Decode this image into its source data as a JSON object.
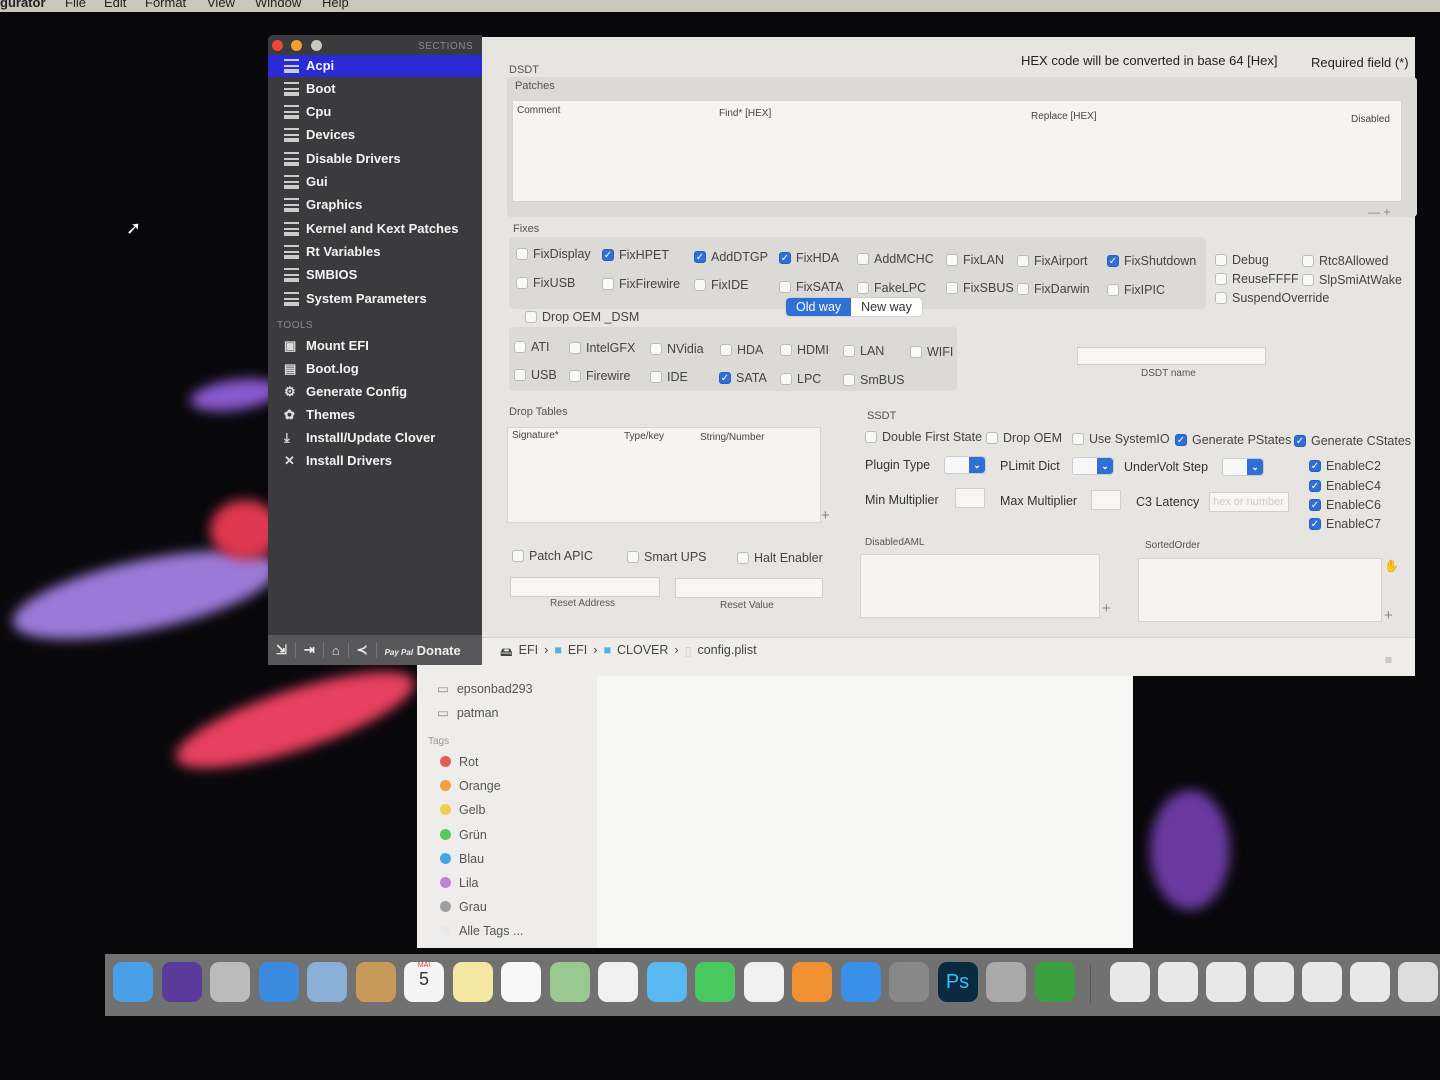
{
  "menubar": {
    "app": "gurator",
    "items": [
      "File",
      "Edit",
      "Format",
      "View",
      "Window",
      "Help"
    ]
  },
  "sidebar": {
    "sections_header": "SECTIONS",
    "sections": [
      "Acpi",
      "Boot",
      "Cpu",
      "Devices",
      "Disable Drivers",
      "Gui",
      "Graphics",
      "Kernel and Kext Patches",
      "Rt Variables",
      "SMBIOS",
      "System Parameters"
    ],
    "selected": "Acpi",
    "tools_header": "TOOLS",
    "tools": [
      {
        "label": "Mount EFI",
        "icon": "disk-icon"
      },
      {
        "label": "Boot.log",
        "icon": "log-icon"
      },
      {
        "label": "Generate Config",
        "icon": "gear-icon"
      },
      {
        "label": "Themes",
        "icon": "palette-icon"
      },
      {
        "label": "Install/Update Clover",
        "icon": "download-icon"
      },
      {
        "label": "Install Drivers",
        "icon": "tools-icon"
      }
    ],
    "footer": {
      "donate": "Donate",
      "paypal": "Pay Pal"
    }
  },
  "header": {
    "hex_note": "HEX code will be converted in base 64 [Hex]",
    "required": "Required field (*)"
  },
  "dsdt": {
    "title": "DSDT",
    "patches_label": "Patches",
    "columns": [
      "Comment",
      "Find* [HEX]",
      "Replace [HEX]",
      "Disabled"
    ],
    "fixes_label": "Fixes",
    "fixes": [
      {
        "l": "FixDisplay",
        "c": false
      },
      {
        "l": "FixHPET",
        "c": true
      },
      {
        "l": "AddDTGP",
        "c": true
      },
      {
        "l": "FixHDA",
        "c": true
      },
      {
        "l": "AddMCHC",
        "c": false
      },
      {
        "l": "FixLAN",
        "c": false
      },
      {
        "l": "FixAirport",
        "c": false
      },
      {
        "l": "FixShutdown",
        "c": true
      },
      {
        "l": "Debug",
        "c": false
      },
      {
        "l": "Rtc8Allowed",
        "c": false
      },
      {
        "l": "FixUSB",
        "c": false
      },
      {
        "l": "FixFirewire",
        "c": false
      },
      {
        "l": "FixIDE",
        "c": false
      },
      {
        "l": "FixSATA",
        "c": false
      },
      {
        "l": "FakeLPC",
        "c": false
      },
      {
        "l": "FixSBUS",
        "c": false
      },
      {
        "l": "FixDarwin",
        "c": false
      },
      {
        "l": "FixIPIC",
        "c": false
      },
      {
        "l": "ReuseFFFF",
        "c": false
      },
      {
        "l": "SlpSmiAtWake",
        "c": false
      },
      {
        "l": "SuspendOverride",
        "c": false
      }
    ],
    "way": {
      "old": "Old way",
      "new": "New way",
      "selected": "Old way"
    },
    "drop_oem_dsm": {
      "l": "Drop OEM _DSM",
      "c": false
    },
    "dsm": [
      {
        "l": "ATI",
        "c": false
      },
      {
        "l": "IntelGFX",
        "c": false
      },
      {
        "l": "NVidia",
        "c": false
      },
      {
        "l": "HDA",
        "c": false
      },
      {
        "l": "HDMI",
        "c": false
      },
      {
        "l": "LAN",
        "c": false
      },
      {
        "l": "WIFI",
        "c": false
      },
      {
        "l": "USB",
        "c": false
      },
      {
        "l": "Firewire",
        "c": false
      },
      {
        "l": "IDE",
        "c": false
      },
      {
        "l": "SATA",
        "c": true
      },
      {
        "l": "LPC",
        "c": false
      },
      {
        "l": "SmBUS",
        "c": false
      }
    ],
    "dsdt_name_label": "DSDT name",
    "dsdt_name": ""
  },
  "drop_tables": {
    "label": "Drop Tables",
    "columns": [
      "Signature*",
      "Type/key",
      "String/Number"
    ]
  },
  "misc": [
    {
      "l": "Patch APIC",
      "c": false
    },
    {
      "l": "Smart UPS",
      "c": false
    },
    {
      "l": "Halt Enabler",
      "c": false
    }
  ],
  "reset_address": "Reset Address",
  "reset_value": "Reset Value",
  "ssdt": {
    "label": "SSDT",
    "checks": [
      {
        "l": "Double First State",
        "c": false
      },
      {
        "l": "Drop OEM",
        "c": false
      },
      {
        "l": "Use SystemIO",
        "c": false
      },
      {
        "l": "Generate PStates",
        "c": true
      },
      {
        "l": "Generate CStates",
        "c": true
      }
    ],
    "plugin_type": "Plugin Type",
    "plimit": "PLimit Dict",
    "undervolt": "UnderVolt Step",
    "min_mult": "Min Multiplier",
    "max_mult": "Max Multiplier",
    "c3": "C3 Latency",
    "c3_placeholder": "hex or number",
    "cstates": [
      {
        "l": "EnableC2",
        "c": true
      },
      {
        "l": "EnableC4",
        "c": true
      },
      {
        "l": "EnableC6",
        "c": true
      },
      {
        "l": "EnableC7",
        "c": true
      }
    ],
    "disabled_aml": "DisabledAML",
    "sorted_order": "SortedOrder"
  },
  "path": [
    "EFI",
    "EFI",
    "CLOVER",
    "config.plist"
  ],
  "finder": {
    "devices": [
      "epsonbad293",
      "patman"
    ],
    "tags_header": "Tags",
    "tags": [
      {
        "l": "Rot",
        "c": "#e85a5a"
      },
      {
        "l": "Orange",
        "c": "#f0a040"
      },
      {
        "l": "Gelb",
        "c": "#f0d050"
      },
      {
        "l": "Grün",
        "c": "#5ac85a"
      },
      {
        "l": "Blau",
        "c": "#40a8e0"
      },
      {
        "l": "Lila",
        "c": "#c080d8"
      },
      {
        "l": "Grau",
        "c": "#a0a0a0"
      },
      {
        "l": "Alle Tags ...",
        "c": "#e8e8e8"
      }
    ]
  },
  "dock": {
    "calendar_month": "MAI",
    "calendar_day": "5",
    "ps": "Ps"
  }
}
